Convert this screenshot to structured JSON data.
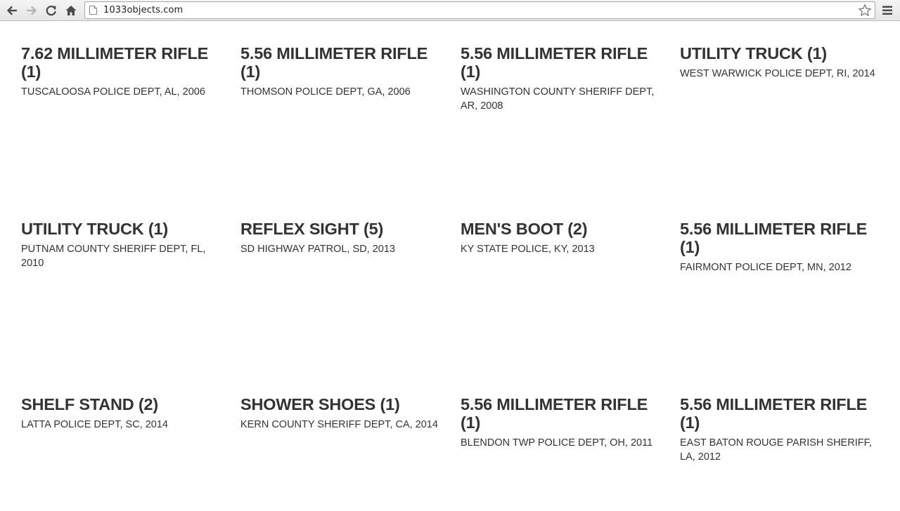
{
  "browser": {
    "url": "1033objects.com"
  },
  "items": [
    {
      "title": "7.62 MILLIMETER RIFLE (1)",
      "desc": "TUSCALOOSA POLICE DEPT, AL, 2006"
    },
    {
      "title": "5.56 MILLIMETER RIFLE (1)",
      "desc": "THOMSON POLICE DEPT, GA, 2006"
    },
    {
      "title": "5.56 MILLIMETER RIFLE (1)",
      "desc": "WASHINGTON COUNTY SHERIFF DEPT, AR, 2008"
    },
    {
      "title": "UTILITY TRUCK (1)",
      "desc": "WEST WARWICK POLICE DEPT, RI, 2014"
    },
    {
      "title": "UTILITY TRUCK (1)",
      "desc": "PUTNAM COUNTY SHERIFF DEPT, FL, 2010"
    },
    {
      "title": "REFLEX SIGHT (5)",
      "desc": "SD HIGHWAY PATROL, SD, 2013"
    },
    {
      "title": "MEN'S BOOT (2)",
      "desc": "KY STATE POLICE, KY, 2013"
    },
    {
      "title": "5.56 MILLIMETER RIFLE (1)",
      "desc": "FAIRMONT POLICE DEPT, MN, 2012"
    },
    {
      "title": "SHELF STAND (2)",
      "desc": "LATTA POLICE DEPT, SC, 2014"
    },
    {
      "title": "SHOWER SHOES (1)",
      "desc": "KERN COUNTY SHERIFF DEPT, CA, 2014"
    },
    {
      "title": "5.56 MILLIMETER RIFLE (1)",
      "desc": "BLENDON TWP POLICE DEPT, OH, 2011"
    },
    {
      "title": "5.56 MILLIMETER RIFLE (1)",
      "desc": "EAST BATON ROUGE PARISH SHERIFF, LA, 2012"
    }
  ]
}
